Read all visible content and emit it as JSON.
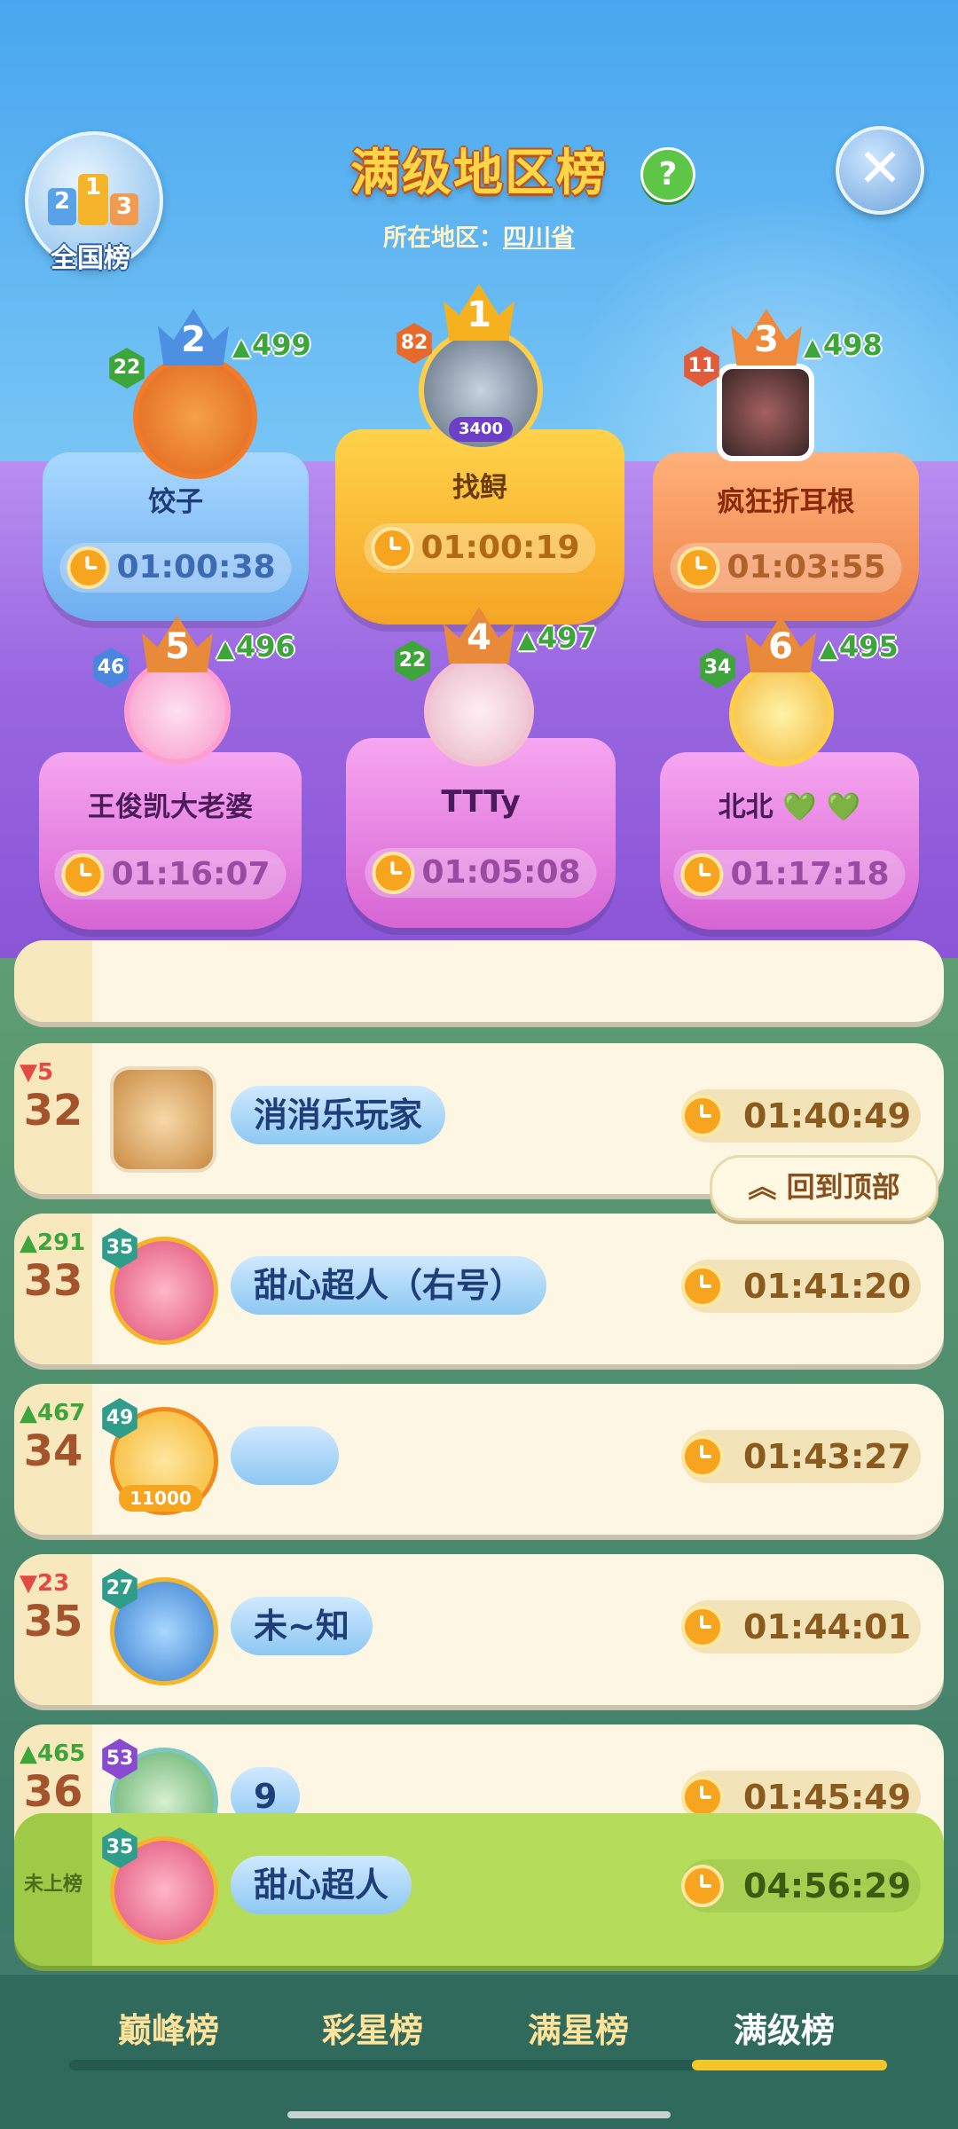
{
  "header": {
    "title": "满级地区榜",
    "help_glyph": "?",
    "region_label": "所在地区：",
    "region_value": "四川省",
    "close_glyph": "✕",
    "national_label": "全国榜",
    "national_digits": [
      "2",
      "1",
      "3"
    ]
  },
  "podium": [
    {
      "rank": "1",
      "level": "82",
      "name": "找鲟",
      "time": "01:00:19",
      "change": "",
      "badge": "3400"
    },
    {
      "rank": "2",
      "level": "22",
      "name": "饺子",
      "time": "01:00:38",
      "change": "499"
    },
    {
      "rank": "3",
      "level": "11",
      "name": "疯狂折耳根",
      "time": "01:03:55",
      "change": "498"
    },
    {
      "rank": "4",
      "level": "22",
      "name": "TTTy",
      "time": "01:05:08",
      "change": "497"
    },
    {
      "rank": "5",
      "level": "46",
      "name": "王俊凯大老婆",
      "time": "01:16:07",
      "change": "496"
    },
    {
      "rank": "6",
      "level": "34",
      "name": "北北 💚 💚",
      "time": "01:17:18",
      "change": "495"
    }
  ],
  "list": [
    {
      "rank": "32",
      "change": "5",
      "direction": "down",
      "level": "",
      "name": "消消乐玩家",
      "time": "01:40:49"
    },
    {
      "rank": "33",
      "change": "291",
      "direction": "up",
      "level": "35",
      "name": "甜心超人（右号）",
      "time": "01:41:20"
    },
    {
      "rank": "34",
      "change": "467",
      "direction": "up",
      "level": "49",
      "name": "",
      "time": "01:43:27",
      "badge": "11000"
    },
    {
      "rank": "35",
      "change": "23",
      "direction": "down",
      "level": "27",
      "name": "未~知",
      "time": "01:44:01"
    },
    {
      "rank": "36",
      "change": "465",
      "direction": "up",
      "level": "53",
      "name": "9",
      "time": "01:45:49"
    }
  ],
  "back_to_top": "回到顶部",
  "mine": {
    "rank_label": "未上榜",
    "level": "35",
    "name": "甜心超人",
    "time": "04:56:29"
  },
  "tabs": [
    {
      "label": "巅峰榜",
      "active": false
    },
    {
      "label": "彩星榜",
      "active": false
    },
    {
      "label": "满星榜",
      "active": false
    },
    {
      "label": "满级榜",
      "active": true
    }
  ],
  "icons": [
    "clock-icon",
    "close-icon",
    "help-icon",
    "crown-icon",
    "up-arrow-icon",
    "down-arrow-icon",
    "double-chevron-up-icon"
  ],
  "colors": {
    "up": "#3ea53a",
    "down": "#e24b43",
    "gold": "#ffd64a",
    "active_tab": "#f5c62b"
  }
}
